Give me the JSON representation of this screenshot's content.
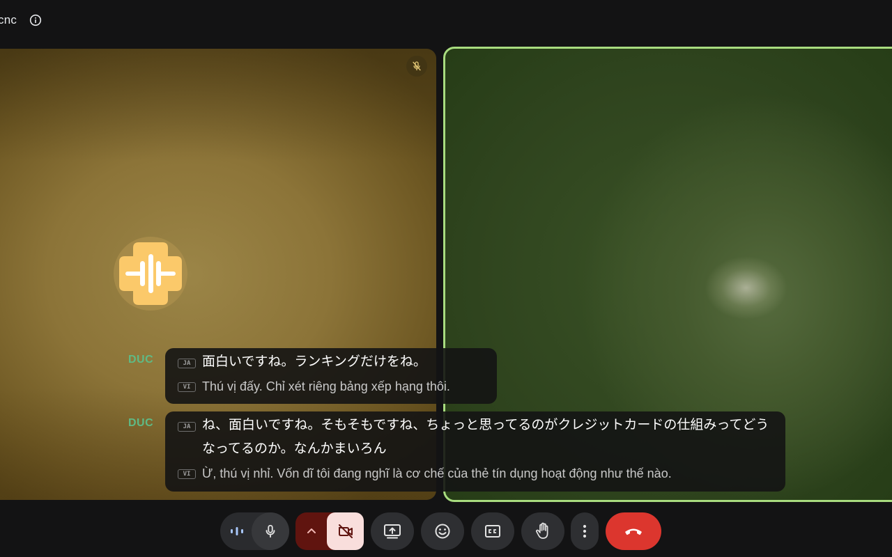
{
  "header": {
    "meeting_title": "cnc",
    "info_icon": "info-icon"
  },
  "tiles": {
    "left": {
      "muted_icon": "mic-off-icon",
      "avatar_icon": "audio-waveform-icon"
    },
    "right": {
      "highlight_color": "#a8dc7f"
    }
  },
  "captions": [
    {
      "speaker": "DUC",
      "lines": [
        {
          "lang": "JA",
          "text": "面白いですね。ランキングだけをね。"
        },
        {
          "lang": "VI",
          "text": "Thú vị đấy. Chỉ xét riêng bảng xếp hạng thôi."
        }
      ]
    },
    {
      "speaker": "DUC",
      "lines": [
        {
          "lang": "JA",
          "text": "ね、面白いですね。そもそもですね、ちょっと思ってるのがクレジットカードの仕組みってどうなってるのか。なんかまいろん"
        },
        {
          "lang": "VI",
          "text": "Ừ, thú vị nhỉ. Vốn dĩ tôi đang nghĩ là cơ chế của thẻ tín dụng hoạt động như thế nào."
        }
      ]
    }
  ],
  "controls": {
    "icons": [
      "audio-level-icon",
      "mic-icon",
      "chevron-up-icon",
      "camera-off-icon",
      "present-screen-icon",
      "emoji-icon",
      "captions-icon",
      "raise-hand-icon",
      "more-options-icon",
      "end-call-icon"
    ],
    "colors": {
      "end_call": "#dc362e",
      "camera_off_bg": "#f9dedc",
      "camera_group_bg": "#60140f",
      "speaker_name": "#5fba85"
    }
  }
}
